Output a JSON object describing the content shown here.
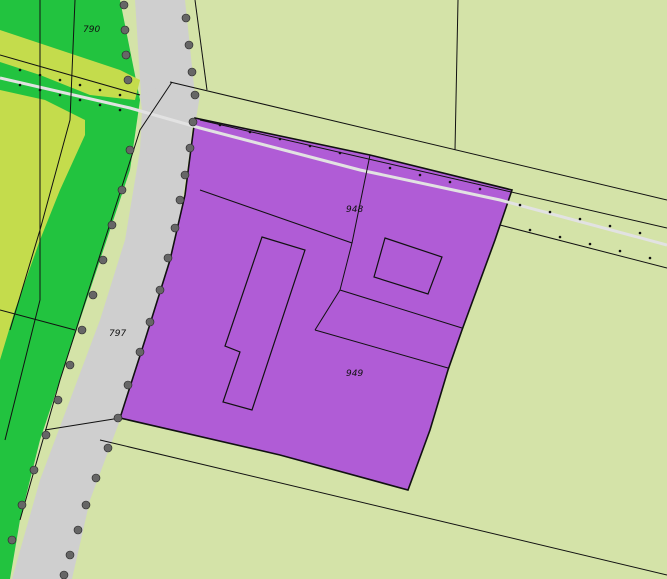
{
  "map": {
    "colors": {
      "agricultural": "#d4e3a8",
      "green_zone": "#22c33f",
      "yellow_zone": "#c4dc4c",
      "road": "#cfcfcf",
      "development": "#b05cd6",
      "boundary": "#111111",
      "track_line": "#e2e2e2"
    },
    "parcels": [
      {
        "id": "790",
        "label": "790"
      },
      {
        "id": "948",
        "label": "948"
      },
      {
        "id": "797",
        "label": "797"
      },
      {
        "id": "949",
        "label": "949"
      }
    ]
  }
}
